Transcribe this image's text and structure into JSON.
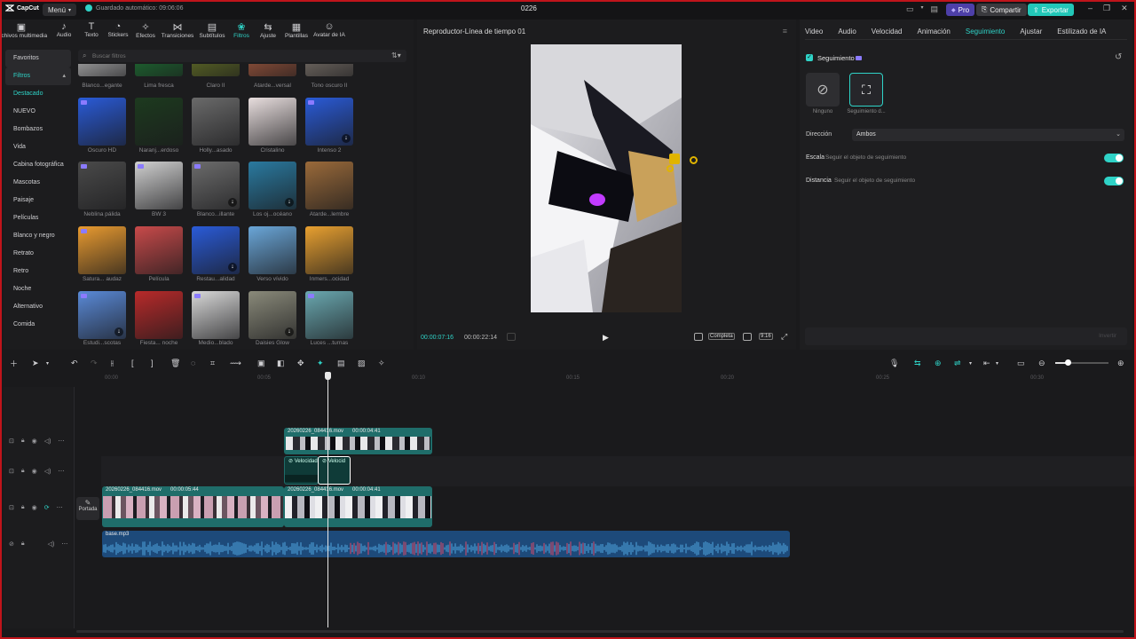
{
  "app": {
    "logo_text": "CapCut",
    "menu_label": "Menú",
    "autosave": "Guardado automático: 09:06:06",
    "project_title": "0226",
    "pro_label": "Pro",
    "share_label": "Compartir",
    "export_label": "Exportar"
  },
  "toolbar": [
    {
      "label": "Archivos multimedia",
      "icon": "media-icon"
    },
    {
      "label": "Audio",
      "icon": "audio-icon"
    },
    {
      "label": "Texto",
      "icon": "text-icon"
    },
    {
      "label": "Stickers",
      "icon": "sticker-icon"
    },
    {
      "label": "Efectos",
      "icon": "effects-icon"
    },
    {
      "label": "Transiciones",
      "icon": "transitions-icon"
    },
    {
      "label": "Subtítulos",
      "icon": "subtitles-icon"
    },
    {
      "label": "Filtros",
      "icon": "filters-icon"
    },
    {
      "label": "Ajuste",
      "icon": "adjust-icon"
    },
    {
      "label": "Plantillas",
      "icon": "templates-icon"
    },
    {
      "label": "Avatar de IA",
      "icon": "ai-avatar-icon"
    }
  ],
  "leftnav": {
    "favorites": "Favoritos",
    "filters": "Filtros",
    "items": [
      "Destacado",
      "NUEVO",
      "Bombazos",
      "Vida",
      "Cabina fotográfica",
      "Mascotas",
      "Paisaje",
      "Películas",
      "Blanco y negro",
      "Retrato",
      "Retro",
      "Noche",
      "Alternativo",
      "Comida"
    ]
  },
  "search": {
    "placeholder": "Buscar filtros"
  },
  "filters": {
    "row0": [
      "Blanco...egante",
      "Lima fresca",
      "Claro II",
      "Atarde...versal",
      "Tono oscuro II"
    ],
    "row1": [
      "Oscuro HD",
      "Naranj...erdoso",
      "Holly...asado",
      "Cristalino",
      "Intenso 2"
    ],
    "row2": [
      "Neblina pálida",
      "BW 3",
      "Blanco...illante",
      "Los oj...océano",
      "Atarde...lembre"
    ],
    "row3": [
      "Satura... audaz",
      "Película",
      "Restau...alidad",
      "Verso vívido",
      "Inmers...ocidad"
    ],
    "row4": [
      "Estudi...scotas",
      "Fiesta... noche",
      "Medio...blado",
      "Daisies Glow",
      "Luces ...turnas"
    ]
  },
  "player": {
    "title": "Reproductor-Línea de tiempo 01",
    "current_time": "00:00:07:16",
    "total_time": "00:00:22:14",
    "view_label": "Completa",
    "ratio_label": "9:16"
  },
  "inspector": {
    "tabs": [
      "Video",
      "Audio",
      "Velocidad",
      "Animación",
      "Seguimiento",
      "Ajustar",
      "Estilizado de IA"
    ],
    "active_tab": "Seguimiento",
    "tracking_label": "Seguimiento",
    "option_none": "Ninguno",
    "option_track": "Seguimiento d...",
    "direction_label": "Dirección",
    "direction_value": "Ambos",
    "scale_label": "Escala",
    "scale_desc": "Seguir el objeto de seguimiento",
    "distance_label": "Distancia",
    "distance_desc": "Seguir el objeto de seguimiento",
    "apply_label": "Invertir"
  },
  "timeline": {
    "ruler": [
      "00:00",
      "00:05",
      "00:10",
      "00:15",
      "00:20",
      "00:25",
      "00:30"
    ],
    "clip_top": {
      "name": "20260226_084416.mov",
      "duration": "00:00:04:41"
    },
    "speed_1": "Velocidad",
    "speed_2": "Velocid",
    "main_clip_a": {
      "name": "20260226_084416.mov",
      "duration": "00:00:05:44"
    },
    "main_clip_b": {
      "name": "20260226_084416.mov",
      "duration": "00:00:04:41"
    },
    "cover_label": "Portada",
    "audio_clip": "base.mp3"
  },
  "colors": {
    "accent": "#2fd3c7",
    "brand_export": "#22c7b8",
    "track_teal": "#1f6d6a",
    "audio_blue": "#1d4a7a",
    "pro_purple": "#4d3fa8"
  }
}
